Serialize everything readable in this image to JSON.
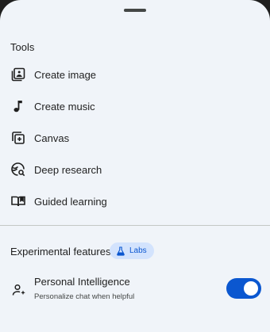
{
  "tools": {
    "title": "Tools",
    "items": [
      {
        "label": "Create image",
        "icon": "image-stack-icon"
      },
      {
        "label": "Create music",
        "icon": "music-note-icon"
      },
      {
        "label": "Canvas",
        "icon": "canvas-icon"
      },
      {
        "label": "Deep research",
        "icon": "deep-research-icon"
      },
      {
        "label": "Guided learning",
        "icon": "book-icon"
      }
    ]
  },
  "experimental": {
    "title": "Experimental features",
    "badge": "Labs",
    "badge_icon": "flask-icon",
    "personal_intelligence": {
      "title": "Personal Intelligence",
      "subtitle": "Personalize chat when helpful",
      "enabled": true,
      "icon": "person-sparkle-icon"
    }
  },
  "colors": {
    "sheet": "#f0f4f9",
    "accent": "#0b57d0",
    "chip": "#d3e3fd"
  }
}
